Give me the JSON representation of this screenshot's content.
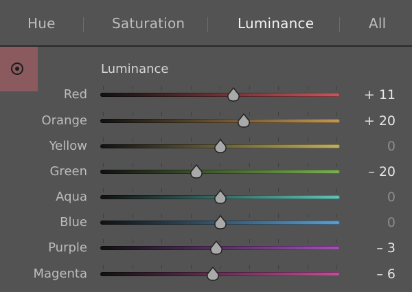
{
  "tabs": [
    {
      "label": "Hue",
      "active": false
    },
    {
      "label": "Saturation",
      "active": false
    },
    {
      "label": "Luminance",
      "active": true
    },
    {
      "label": "All",
      "active": false
    }
  ],
  "panel": {
    "title": "Luminance",
    "target_icon": "target-adjust-icon",
    "target_color": "#8a5a5f"
  },
  "sliders": [
    {
      "label": "Red",
      "value": "+ 11",
      "numeric": 11,
      "min": -100,
      "max": 100,
      "color": "#c8555c"
    },
    {
      "label": "Orange",
      "value": "+ 20",
      "numeric": 20,
      "min": -100,
      "max": 100,
      "color": "#c39654"
    },
    {
      "label": "Yellow",
      "value": "0",
      "numeric": 0,
      "min": -100,
      "max": 100,
      "color": "#c0b060"
    },
    {
      "label": "Green",
      "value": "– 20",
      "numeric": -20,
      "min": -100,
      "max": 100,
      "color": "#7ab150"
    },
    {
      "label": "Aqua",
      "value": "0",
      "numeric": 0,
      "min": -100,
      "max": 100,
      "color": "#5fc4b7"
    },
    {
      "label": "Blue",
      "value": "0",
      "numeric": 0,
      "min": -100,
      "max": 100,
      "color": "#5a9ed1"
    },
    {
      "label": "Purple",
      "value": "– 3",
      "numeric": -3,
      "min": -100,
      "max": 100,
      "color": "#a050b8"
    },
    {
      "label": "Magenta",
      "value": "– 6",
      "numeric": -6,
      "min": -100,
      "max": 100,
      "color": "#c04e97"
    }
  ]
}
